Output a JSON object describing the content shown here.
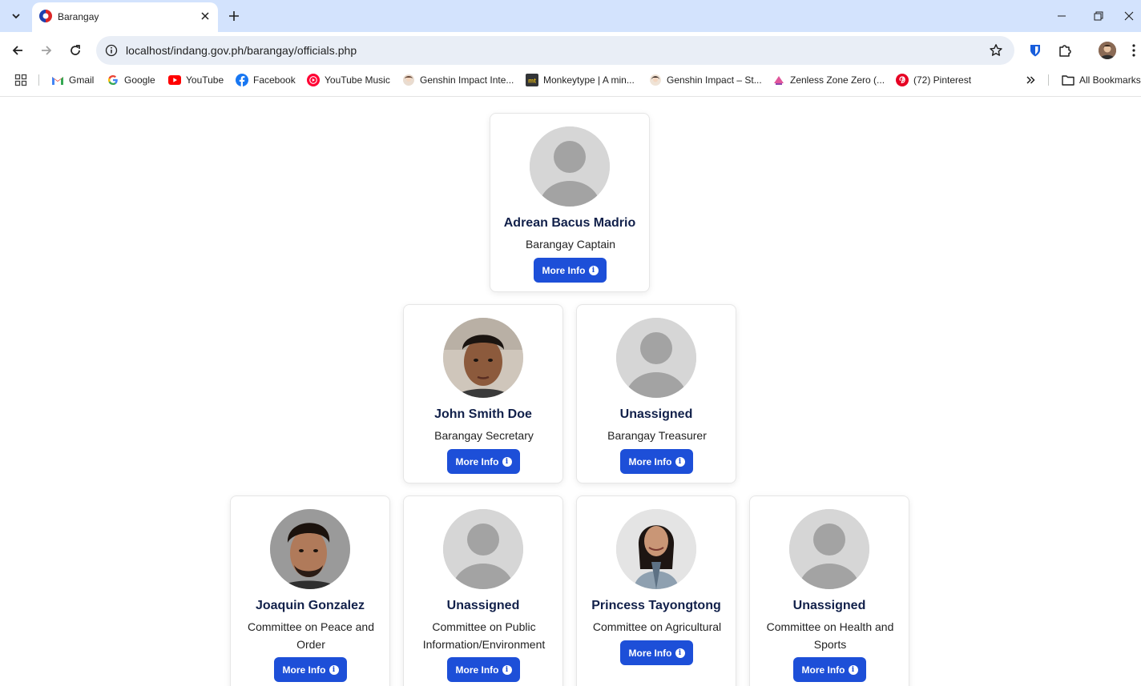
{
  "browser": {
    "tab_title": "Barangay",
    "url": "localhost/indang.gov.ph/barangay/officials.php",
    "bookmarks": [
      {
        "label": "Gmail",
        "icon": "gmail-icon"
      },
      {
        "label": "Google",
        "icon": "google-icon"
      },
      {
        "label": "YouTube",
        "icon": "youtube-icon"
      },
      {
        "label": "Facebook",
        "icon": "facebook-icon"
      },
      {
        "label": "YouTube Music",
        "icon": "youtube-music-icon"
      },
      {
        "label": "Genshin Impact Inte...",
        "icon": "genshin-icon"
      },
      {
        "label": "Monkeytype | A min...",
        "icon": "monkeytype-icon"
      },
      {
        "label": "Genshin Impact – St...",
        "icon": "genshin-icon"
      },
      {
        "label": "Zenless Zone Zero (...",
        "icon": "zenless-icon"
      },
      {
        "label": "(72) Pinterest",
        "icon": "pinterest-icon"
      }
    ],
    "all_bookmarks_label": "All Bookmarks",
    "colors": {
      "tabstrip": "#d3e3fd",
      "omnibox": "#e9eef6"
    }
  },
  "officials": {
    "button_label": "More Info",
    "button_color": "#1d4fd8",
    "name_color": "#11204a",
    "cards": [
      {
        "name": "Adrean Bacus Madrio",
        "role": "Barangay Captain",
        "photo": "placeholder"
      },
      {
        "name": "John Smith Doe",
        "role": "Barangay Secretary",
        "photo": "portrait-man-1"
      },
      {
        "name": "Unassigned",
        "role": "Barangay Treasurer",
        "photo": "placeholder"
      },
      {
        "name": "Joaquin Gonzalez",
        "role": "Committee on Peace and Order",
        "photo": "portrait-man-2"
      },
      {
        "name": "Unassigned",
        "role": "Committee on Public Information/Environment",
        "photo": "placeholder"
      },
      {
        "name": "Princess Tayongtong",
        "role": "Committee on Agricultural",
        "photo": "portrait-woman"
      },
      {
        "name": "Unassigned",
        "role": "Committee on Health and Sports",
        "photo": "placeholder"
      }
    ]
  }
}
